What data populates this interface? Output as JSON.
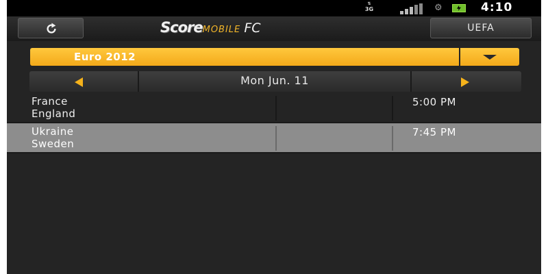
{
  "status_bar": {
    "network": "3G",
    "time": "4:10"
  },
  "header": {
    "logo": {
      "score": "Score",
      "mobile": "MOBILE",
      "fc": "FC"
    },
    "uefa_label": "UEFA"
  },
  "competition": {
    "selected": "Euro 2012"
  },
  "date_nav": {
    "date": "Mon Jun. 11"
  },
  "matches": [
    {
      "home": "France",
      "away": "England",
      "time": "5:00 PM",
      "highlighted": false
    },
    {
      "home": "Ukraine",
      "away": "Sweden",
      "time": "7:45 PM",
      "highlighted": true
    }
  ],
  "colors": {
    "accent": "#f5b21b",
    "background": "#242424",
    "highlight_row": "#8d8d8d"
  }
}
